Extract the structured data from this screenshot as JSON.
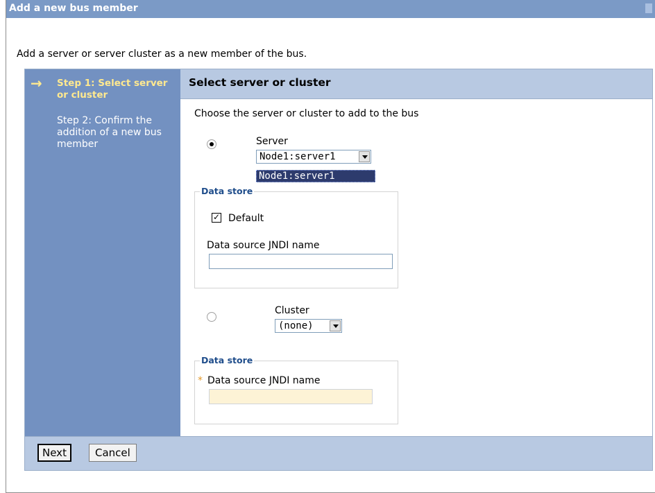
{
  "window": {
    "title": "Add a new bus member"
  },
  "intro": "Add a server or server cluster as a new member of the bus.",
  "steps": [
    {
      "label": "Step 1: Select server or cluster",
      "active": true
    },
    {
      "label": "Step 2: Confirm the addition of a new bus member",
      "active": false
    }
  ],
  "main": {
    "heading": "Select server or cluster",
    "instruction": "Choose the server or cluster to add to the bus",
    "server": {
      "label": "Server",
      "selected": true,
      "select_value": "Node1:server1",
      "dropdown_options": [
        "Node1:server1"
      ]
    },
    "server_data_store": {
      "legend": "Data store",
      "default_label": "Default",
      "default_checked": true,
      "jndi_label": "Data source JNDI name",
      "jndi_value": ""
    },
    "cluster": {
      "label": "Cluster",
      "selected": false,
      "select_value": "(none)"
    },
    "cluster_data_store": {
      "legend": "Data store",
      "required_marker": "*",
      "jndi_label": "Data source JNDI name",
      "jndi_value": ""
    }
  },
  "footer": {
    "next_label": "Next",
    "cancel_label": "Cancel"
  },
  "colors": {
    "titlebar": "#7b9ac6",
    "steps_panel": "#7391c1",
    "active_step": "#ffe98f",
    "header_band": "#b8c9e2"
  }
}
